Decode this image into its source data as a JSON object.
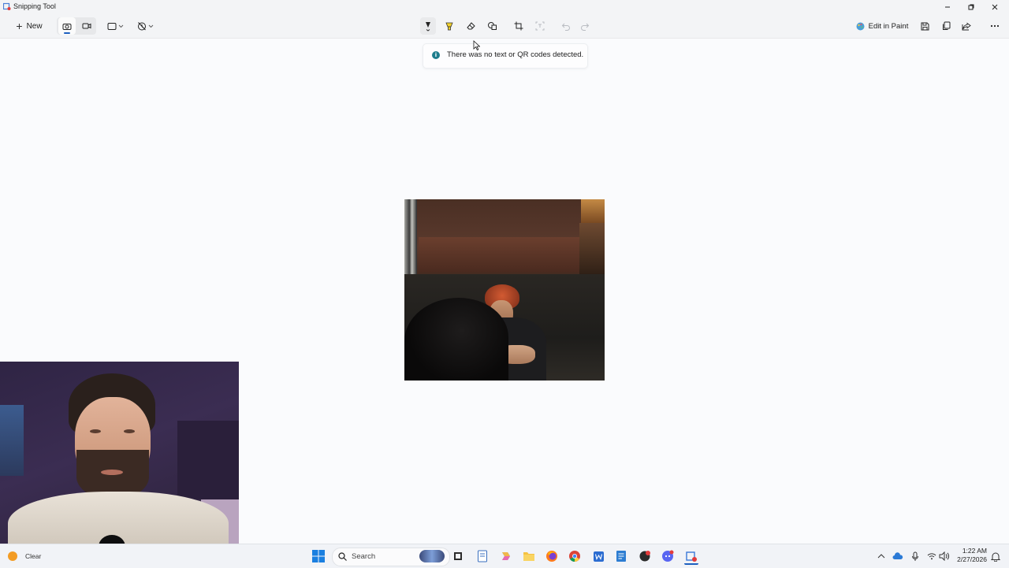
{
  "window": {
    "title": "Snipping Tool"
  },
  "toolbar": {
    "new_label": "New",
    "edit_in_paint_label": "Edit in Paint"
  },
  "notification": {
    "message": "There was no text or QR codes detected.",
    "icon": "info-icon"
  },
  "taskbar": {
    "weather_label": "Clear",
    "search_placeholder": "Search",
    "apps": [
      "start-icon",
      "search-icon",
      "file-explorer-icon",
      "notepad-icon",
      "copilot-icon",
      "folder-icon",
      "firefox-icon",
      "chrome-icon",
      "word-icon",
      "notes-icon",
      "app-icon",
      "discord-icon",
      "snipping-tool-icon"
    ],
    "clock_time": "1:22 AM",
    "clock_date": "2/27/2026"
  },
  "colors": {
    "accent": "#1d5fbf",
    "info": "#1d7d8c",
    "background": "#fafbfd"
  }
}
